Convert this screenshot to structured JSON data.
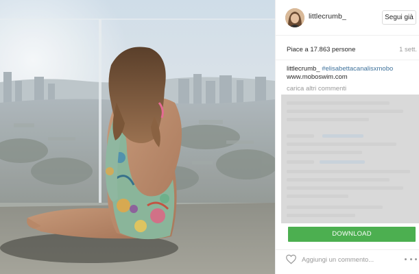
{
  "header": {
    "username": "littlecrumb_",
    "follow_label": "Segui già"
  },
  "stats": {
    "likes": "Piace a 17.863 persone",
    "time": "1 sett."
  },
  "caption": {
    "user": "littlecrumb_",
    "hashtag": "#elisabettacanalisxmobo",
    "website": "www.moboswim.com"
  },
  "comments": {
    "load_more": "carica altri commenti"
  },
  "download": {
    "label": "DOWNLOAD"
  },
  "footer": {
    "comment_placeholder": "Aggiungi un commento..."
  },
  "icons": {
    "like": "heart-icon",
    "options": "more-options-icon"
  },
  "colors": {
    "download_button": "#4caf50",
    "hashtag_link": "#3f729b",
    "overlay": "#d9d9d9"
  }
}
